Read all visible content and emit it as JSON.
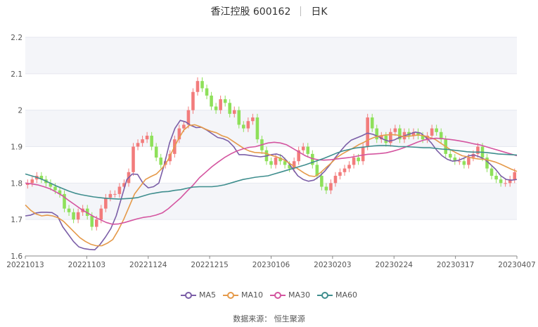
{
  "header": {
    "stock": "香江控股 600162",
    "period": "日K"
  },
  "source": "数据来源： 恒生聚源",
  "chart_data": {
    "type": "candlestick",
    "title": "香江控股 600162 日K",
    "x_labels": [
      "20221013",
      "20221103",
      "20221124",
      "20221215",
      "20230106",
      "20230203",
      "20230224",
      "20230317",
      "20230407"
    ],
    "ylim": [
      1.6,
      2.2
    ],
    "y_ticks": [
      1.6,
      1.7,
      1.8,
      1.9,
      2,
      2.1,
      2.2
    ],
    "grid": true,
    "legend_position": "bottom",
    "up_color": "#f27c7c",
    "down_color": "#8ee05a",
    "close": [
      1.8,
      1.81,
      1.82,
      1.81,
      1.8,
      1.79,
      1.78,
      1.77,
      1.73,
      1.72,
      1.7,
      1.72,
      1.73,
      1.71,
      1.68,
      1.7,
      1.73,
      1.76,
      1.77,
      1.77,
      1.79,
      1.8,
      1.83,
      1.9,
      1.91,
      1.92,
      1.93,
      1.9,
      1.87,
      1.85,
      1.86,
      1.88,
      1.92,
      1.95,
      1.96,
      2.0,
      2.05,
      2.08,
      2.06,
      2.04,
      2.01,
      2.0,
      2.03,
      2.02,
      1.99,
      2.0,
      1.96,
      1.95,
      1.97,
      1.98,
      1.92,
      1.89,
      1.86,
      1.85,
      1.87,
      1.86,
      1.85,
      1.84,
      1.86,
      1.89,
      1.9,
      1.88,
      1.85,
      1.82,
      1.79,
      1.78,
      1.8,
      1.82,
      1.83,
      1.84,
      1.85,
      1.87,
      1.86,
      1.9,
      1.98,
      1.95,
      1.92,
      1.93,
      1.91,
      1.94,
      1.95,
      1.92,
      1.94,
      1.93,
      1.94,
      1.93,
      1.92,
      1.93,
      1.95,
      1.94,
      1.92,
      1.88,
      1.87,
      1.86,
      1.86,
      1.85,
      1.87,
      1.88,
      1.9,
      1.87,
      1.84,
      1.82,
      1.81,
      1.8,
      1.8,
      1.81,
      1.83
    ],
    "series": [
      {
        "name": "MA5",
        "color": "#7b5ea7",
        "values": [
          1.71,
          1.712,
          1.718,
          1.72,
          1.72,
          1.719,
          1.71,
          1.68,
          1.66,
          1.64,
          1.625,
          1.62,
          1.618,
          1.617,
          1.632,
          1.652,
          1.675,
          1.71,
          1.76,
          1.81,
          1.825,
          1.824,
          1.8,
          1.787,
          1.79,
          1.8,
          1.85,
          1.91,
          1.95,
          1.972,
          1.968,
          1.958,
          1.952,
          1.953,
          1.945,
          1.935,
          1.925,
          1.922,
          1.915,
          1.9,
          1.878,
          1.878,
          1.876,
          1.874,
          1.872,
          1.874,
          1.878,
          1.88,
          1.875,
          1.86,
          1.84,
          1.82,
          1.81,
          1.805,
          1.808,
          1.818,
          1.832,
          1.85,
          1.87,
          1.888,
          1.905,
          1.918,
          1.924,
          1.93,
          1.937,
          1.934,
          1.928,
          1.92,
          1.915,
          1.918,
          1.925,
          1.93,
          1.935,
          1.94,
          1.937,
          1.925,
          1.91,
          1.89,
          1.875,
          1.865,
          1.86,
          1.862,
          1.868,
          1.875,
          1.877,
          1.872,
          1.865,
          1.852,
          1.838,
          1.82,
          1.81,
          1.808,
          1.81
        ]
      },
      {
        "name": "MA10",
        "color": "#e59a4a",
        "values": [
          1.74,
          1.725,
          1.715,
          1.71,
          1.712,
          1.71,
          1.705,
          1.695,
          1.68,
          1.665,
          1.65,
          1.64,
          1.632,
          1.628,
          1.628,
          1.635,
          1.645,
          1.67,
          1.7,
          1.735,
          1.77,
          1.79,
          1.81,
          1.818,
          1.825,
          1.84,
          1.86,
          1.89,
          1.92,
          1.945,
          1.958,
          1.96,
          1.955,
          1.948,
          1.942,
          1.938,
          1.93,
          1.925,
          1.915,
          1.905,
          1.895,
          1.888,
          1.884,
          1.883,
          1.882,
          1.876,
          1.872,
          1.866,
          1.858,
          1.848,
          1.838,
          1.828,
          1.82,
          1.818,
          1.828,
          1.842,
          1.855,
          1.87,
          1.88,
          1.888,
          1.896,
          1.905,
          1.912,
          1.92,
          1.926,
          1.93,
          1.932,
          1.933,
          1.932,
          1.928,
          1.928,
          1.93,
          1.932,
          1.93,
          1.925,
          1.92,
          1.91,
          1.9,
          1.89,
          1.882,
          1.875,
          1.872,
          1.868,
          1.866,
          1.865,
          1.862,
          1.858,
          1.852,
          1.845,
          1.838,
          1.832
        ]
      },
      {
        "name": "MA30",
        "color": "#d455a0",
        "values": [
          1.8,
          1.798,
          1.795,
          1.79,
          1.784,
          1.775,
          1.765,
          1.752,
          1.74,
          1.728,
          1.718,
          1.708,
          1.7,
          1.692,
          1.687,
          1.688,
          1.692,
          1.697,
          1.702,
          1.706,
          1.708,
          1.712,
          1.718,
          1.73,
          1.745,
          1.76,
          1.778,
          1.795,
          1.815,
          1.83,
          1.845,
          1.858,
          1.87,
          1.88,
          1.888,
          1.894,
          1.898,
          1.9,
          1.905,
          1.91,
          1.912,
          1.91,
          1.905,
          1.895,
          1.885,
          1.875,
          1.868,
          1.864,
          1.863,
          1.864,
          1.866,
          1.868,
          1.87,
          1.873,
          1.876,
          1.879,
          1.88,
          1.881,
          1.883,
          1.887,
          1.892,
          1.898,
          1.905,
          1.912,
          1.918,
          1.921,
          1.923,
          1.922,
          1.92,
          1.918,
          1.915,
          1.912,
          1.908,
          1.905,
          1.9,
          1.895,
          1.89,
          1.885,
          1.88,
          1.875
        ]
      },
      {
        "name": "MA60",
        "color": "#3f8e8e",
        "values": [
          1.825,
          1.82,
          1.815,
          1.808,
          1.8,
          1.792,
          1.785,
          1.778,
          1.772,
          1.768,
          1.765,
          1.762,
          1.76,
          1.758,
          1.757,
          1.756,
          1.757,
          1.758,
          1.76,
          1.765,
          1.77,
          1.773,
          1.776,
          1.777,
          1.78,
          1.782,
          1.786,
          1.789,
          1.79,
          1.79,
          1.79,
          1.792,
          1.795,
          1.8,
          1.805,
          1.81,
          1.813,
          1.816,
          1.818,
          1.82,
          1.825,
          1.83,
          1.835,
          1.84,
          1.845,
          1.85,
          1.856,
          1.862,
          1.868,
          1.875,
          1.882,
          1.888,
          1.892,
          1.896,
          1.898,
          1.9,
          1.902,
          1.903,
          1.903,
          1.902,
          1.9,
          1.9,
          1.899,
          1.898,
          1.897,
          1.897,
          1.895,
          1.893,
          1.892,
          1.89,
          1.888,
          1.886,
          1.885,
          1.885,
          1.884,
          1.882,
          1.88,
          1.879,
          1.878,
          1.877
        ]
      }
    ]
  }
}
